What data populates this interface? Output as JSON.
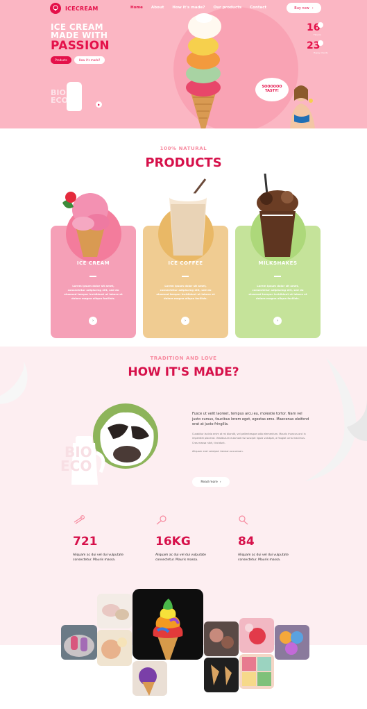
{
  "brand": {
    "name": "ICECREAM"
  },
  "nav": {
    "items": [
      "Home",
      "About",
      "How it's made?",
      "Our products",
      "Contact"
    ]
  },
  "header": {
    "buy_label": "Buy now",
    "buy_arrow": "›"
  },
  "hero": {
    "title_line1": "ICE CREAM",
    "title_line2": "MADE WITH",
    "title_line3": "PASSION",
    "btn_products": "Products",
    "btn_how": "How it's made?",
    "stat1_value": "16",
    "stat1_label": "Flavors",
    "stat2_value": "23",
    "stat2_label": "Happy clients",
    "bio_text": "BIO\nECO",
    "tasty_text": "SOOOOOO TASTY!"
  },
  "products": {
    "eyebrow": "100% NATURAL",
    "title": "PRODUCTS",
    "cards": [
      {
        "name": "ICE CREAM",
        "desc": "Lorem ipsum dolor sit amet, consectetur adipiscing elit, sed do eiusmod tempor incididunt ut labore et dolore magna aliqua facilisis.",
        "color": "#f5a0b7",
        "circle": "#f37c9c"
      },
      {
        "name": "ICE COFFEE",
        "desc": "Lorem ipsum dolor sit amet, consectetur adipiscing elit, sed do eiusmod tempor incididunt ut labore et dolore magna aliqua facilisis.",
        "color": "#f0cc92",
        "circle": "#e9b866"
      },
      {
        "name": "MILKSHAKES",
        "desc": "Lorem ipsum dolor sit amet, consectetur adipiscing elit, sed do eiusmod tempor incididunt ut labore et dolore magna aliqua facilisis.",
        "color": "#c5e39a",
        "circle": "#add87a"
      }
    ],
    "dash": "---"
  },
  "how": {
    "eyebrow": "TRADITION AND LOVE",
    "title": "HOW IT'S MADE?",
    "lead": "Fusce ut velit laoreet, tempus arcu eu, molestie tortor. Nam vel justo cursus, faucibus lorem eget, egestas eros. Maecenas eleifend erat at justo fringilla.",
    "para1": "Curabitur lacinia enim at mi blandit, vel pellentesque odio elementum. Mauris rhoncus orci in imperdiet placerat. Vestibulum euismod nisl suscipit ligula volutpat, a feugiat urna maximus. Cras massa nibh, tincidunt.",
    "para2": "Aliquam erat volutpat. Aenean accumsan.",
    "read_more": "Read more",
    "stats": [
      {
        "value": "721",
        "desc": "Aliquam ac dui vel dui vulputate consectetur. Mauris massa.",
        "icon": "ice-cream-icon"
      },
      {
        "value": "16KG",
        "desc": "Aliquam ac dui vel dui vulputate consectetur. Mauris massa.",
        "icon": "scoop-icon"
      },
      {
        "value": "84",
        "desc": "Aliquam ac dui vel dui vulputate consectetur. Mauris massa.",
        "icon": "cone-icon"
      }
    ]
  },
  "colors": {
    "accent": "#e4114a",
    "hero_bg": "#fbb6c3",
    "pink_light": "#fdeef1"
  }
}
